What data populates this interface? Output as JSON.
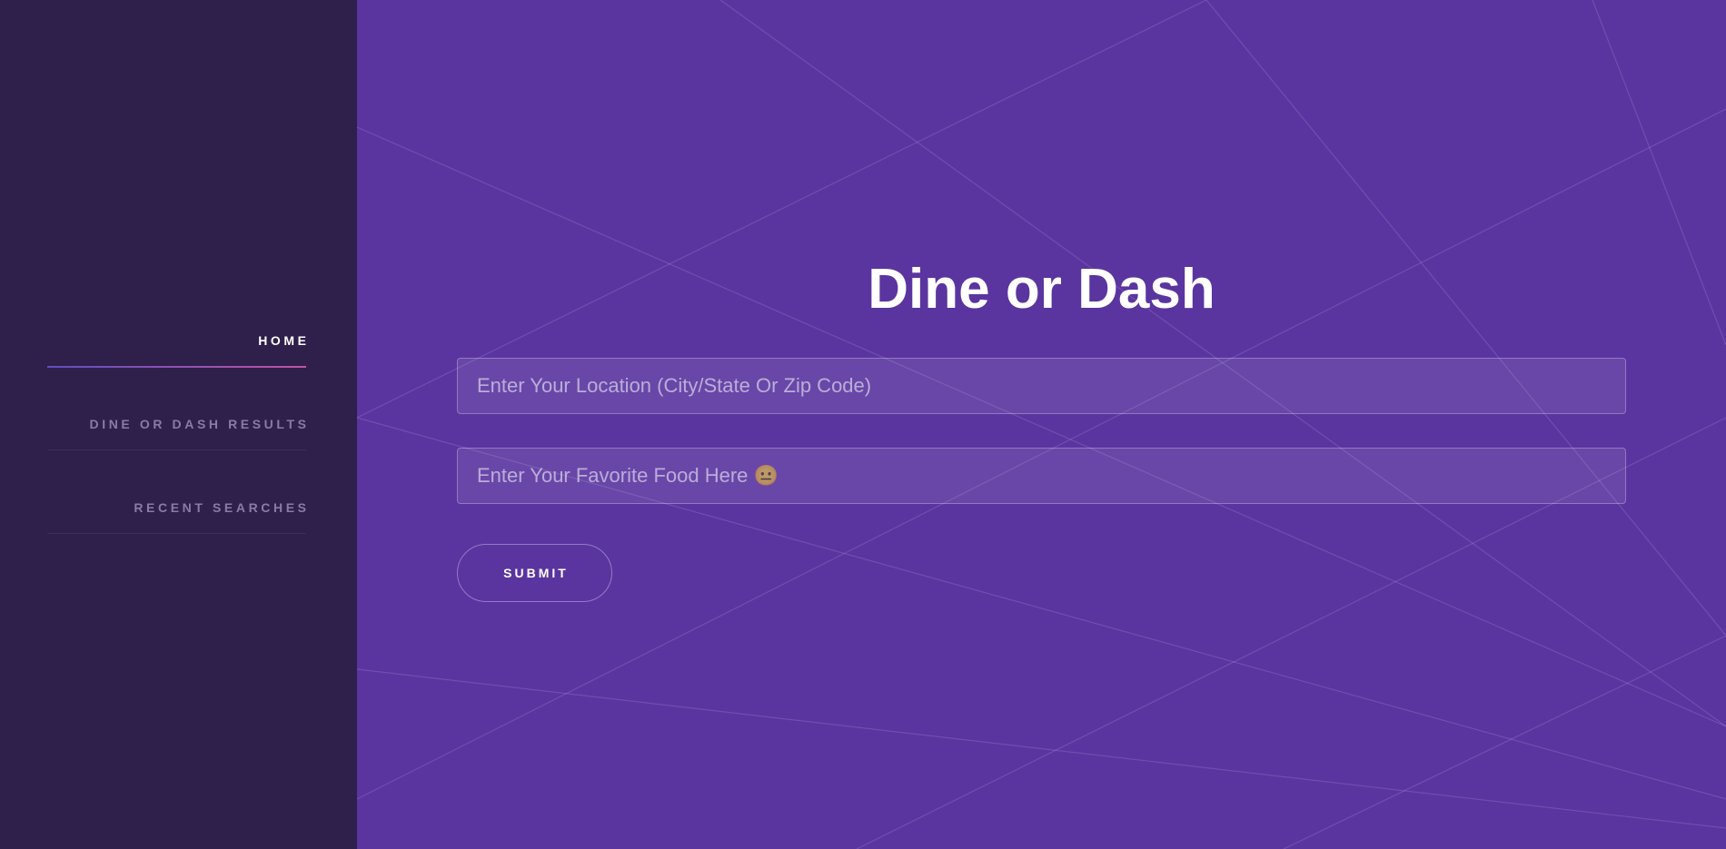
{
  "sidebar": {
    "items": [
      {
        "label": "HOME",
        "active": true
      },
      {
        "label": "DINE OR DASH RESULTS",
        "active": false
      },
      {
        "label": "RECENT SEARCHES",
        "active": false
      }
    ]
  },
  "main": {
    "title": "Dine or Dash",
    "location_input": {
      "value": "",
      "placeholder": "Enter Your Location (City/State Or Zip Code)"
    },
    "food_input": {
      "value": "",
      "placeholder": "Enter Your Favorite Food Here 😐"
    },
    "submit_label": "SUBMIT"
  },
  "colors": {
    "sidebar_bg": "#2e1f4b",
    "main_bg": "#5a35a0",
    "accent_gradient_start": "#5f4fc0",
    "accent_gradient_end": "#c153a4"
  }
}
